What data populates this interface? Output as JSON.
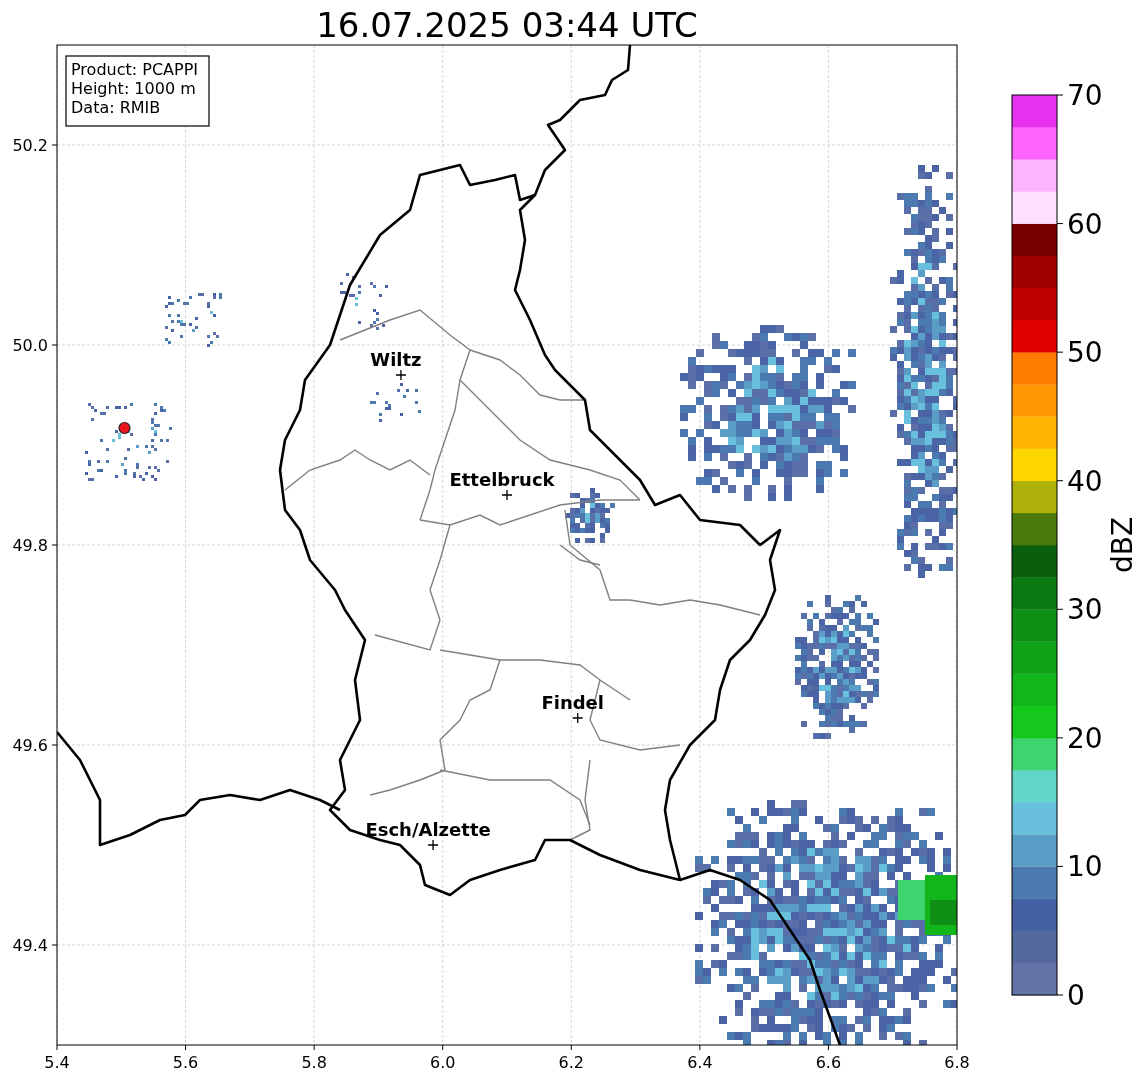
{
  "title": "16.07.2025 03:44 UTC",
  "info_box": [
    "Product: PCAPPI",
    "Height: 1000 m",
    "Data: RMIB"
  ],
  "map": {
    "xticks": [
      "5.4",
      "5.6",
      "5.8",
      "6.0",
      "6.2",
      "6.4",
      "6.6",
      "6.8"
    ],
    "yticks": [
      "50.2",
      "50.0",
      "49.8",
      "49.6",
      "49.4"
    ],
    "cities": [
      {
        "name": "Wiltz"
      },
      {
        "name": "Ettelbruck"
      },
      {
        "name": "Findel"
      },
      {
        "name": "Esch/Alzette"
      }
    ]
  },
  "colorbar": {
    "label": "dBZ",
    "ticks": [
      "70",
      "60",
      "50",
      "40",
      "30",
      "20",
      "10",
      "0"
    ],
    "bins": [
      {
        "color": "#6373a5"
      },
      {
        "color": "#53689e"
      },
      {
        "color": "#4560a3"
      },
      {
        "color": "#4a7ab0"
      },
      {
        "color": "#5a9ec8"
      },
      {
        "color": "#68c0dc"
      },
      {
        "color": "#62d6c8"
      },
      {
        "color": "#3ed46e"
      },
      {
        "color": "#14c81c"
      },
      {
        "color": "#12b61a"
      },
      {
        "color": "#10a216"
      },
      {
        "color": "#0e8e14"
      },
      {
        "color": "#0c7a12"
      },
      {
        "color": "#0a5e0c"
      },
      {
        "color": "#4a7a0c"
      },
      {
        "color": "#b0b00a"
      },
      {
        "color": "#ffd700"
      },
      {
        "color": "#ffb400"
      },
      {
        "color": "#ff9800"
      },
      {
        "color": "#ff7c00"
      },
      {
        "color": "#e00000"
      },
      {
        "color": "#c00000"
      },
      {
        "color": "#a00000"
      },
      {
        "color": "#780000"
      },
      {
        "color": "#ffe0ff"
      },
      {
        "color": "#ffb4ff"
      },
      {
        "color": "#ff64ff"
      },
      {
        "color": "#e632ee"
      }
    ]
  }
}
